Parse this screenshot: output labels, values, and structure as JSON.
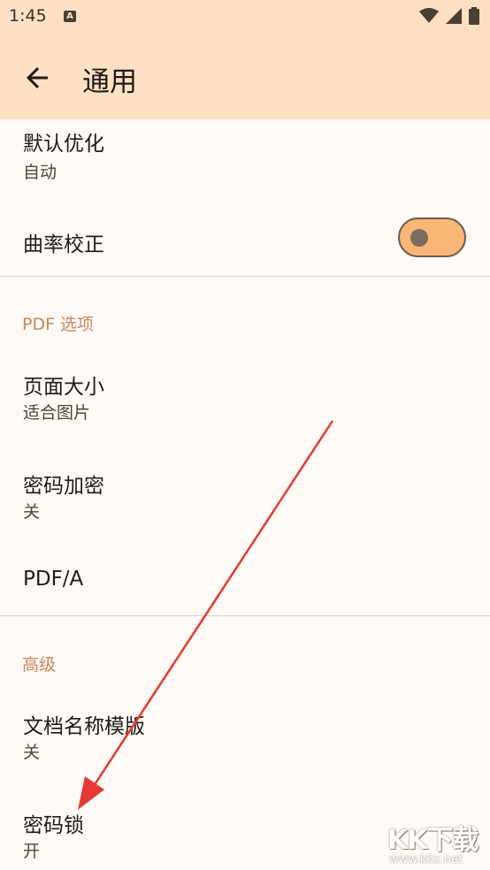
{
  "status_bar": {
    "time": "1:45",
    "notification_icon_letter": "A"
  },
  "app_bar": {
    "title": "通用"
  },
  "general_prefs": {
    "optimization": {
      "title": "默认优化",
      "summary": "自动"
    },
    "curvature": {
      "title": "曲率校正",
      "toggle_on": false
    }
  },
  "pdf_section": {
    "header": "PDF 选项",
    "page_size": {
      "title": "页面大小",
      "summary": "适合图片"
    },
    "password": {
      "title": "密码加密",
      "summary": "关"
    },
    "pdfa": {
      "title": "PDF/A"
    }
  },
  "advanced_section": {
    "header": "高级",
    "name_template": {
      "title": "文档名称模版",
      "summary": "关"
    },
    "lock": {
      "title": "密码锁",
      "summary": "开"
    }
  },
  "watermark": {
    "logo": "KK下载",
    "url": "www.kkx.net"
  },
  "colors": {
    "app_bar": "#fde0c3",
    "accent": "#c8875c",
    "toggle_track": "#f9b676",
    "arrow": "#e53935"
  }
}
